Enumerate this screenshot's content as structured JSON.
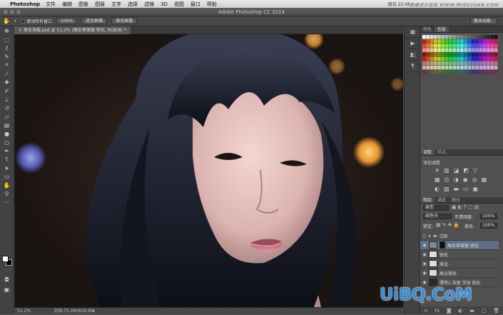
{
  "menubar": {
    "app": "Photoshop",
    "items": [
      "文件",
      "编辑",
      "图像",
      "图层",
      "文字",
      "选择",
      "滤镜",
      "3D",
      "视图",
      "窗口",
      "帮助"
    ],
    "clock": "周日 22:06",
    "watermark": "思缘设计论坛 WWW.MISSVUAN.COM"
  },
  "titlebar": {
    "title": "Adobe Photoshop CC 2014"
  },
  "options": {
    "scroll_all": "滚动所有窗口",
    "zoom": "100%",
    "fit_screen": "适合屏幕",
    "fill_screen": "填充屏幕",
    "workspace": "基本功能"
  },
  "document": {
    "tab": "美女海报.psd @ 51.2% (高反差保留-锐化, RGB/8) *",
    "zoom": "51.2%",
    "doc_size": "文档:75.0M/818.9M"
  },
  "panels": {
    "swatch_tabs": [
      "颜色",
      "色板"
    ],
    "adjust_tabs": [
      "调整",
      "样式"
    ],
    "adjust_title": "添加调整",
    "layer_tabs": [
      "图层",
      "通道",
      "路径"
    ],
    "kind": "类型",
    "blend_mode": "线性光",
    "opacity_label": "不透明度:",
    "opacity": "100%",
    "lock_label": "锁定:",
    "fill_label": "填充:",
    "fill": "100%",
    "layers": [
      {
        "name": "试验",
        "type": "group"
      },
      {
        "name": "高反差保留-锐化",
        "type": "layer",
        "selected": true
      },
      {
        "name": "锐化",
        "type": "layer"
      },
      {
        "name": "美化",
        "type": "layer"
      },
      {
        "name": "高尖美化",
        "type": "layer"
      },
      {
        "name": "漂亮1 去斑 字体 锐化",
        "type": "layer"
      }
    ]
  },
  "site_mark": "UiBQ.CoM",
  "colors": {
    "canvas_bg": "#2a1d18",
    "panel": "#505050",
    "selected_layer": "#5f6f84",
    "watermark_blue": "#3b8dd8"
  }
}
